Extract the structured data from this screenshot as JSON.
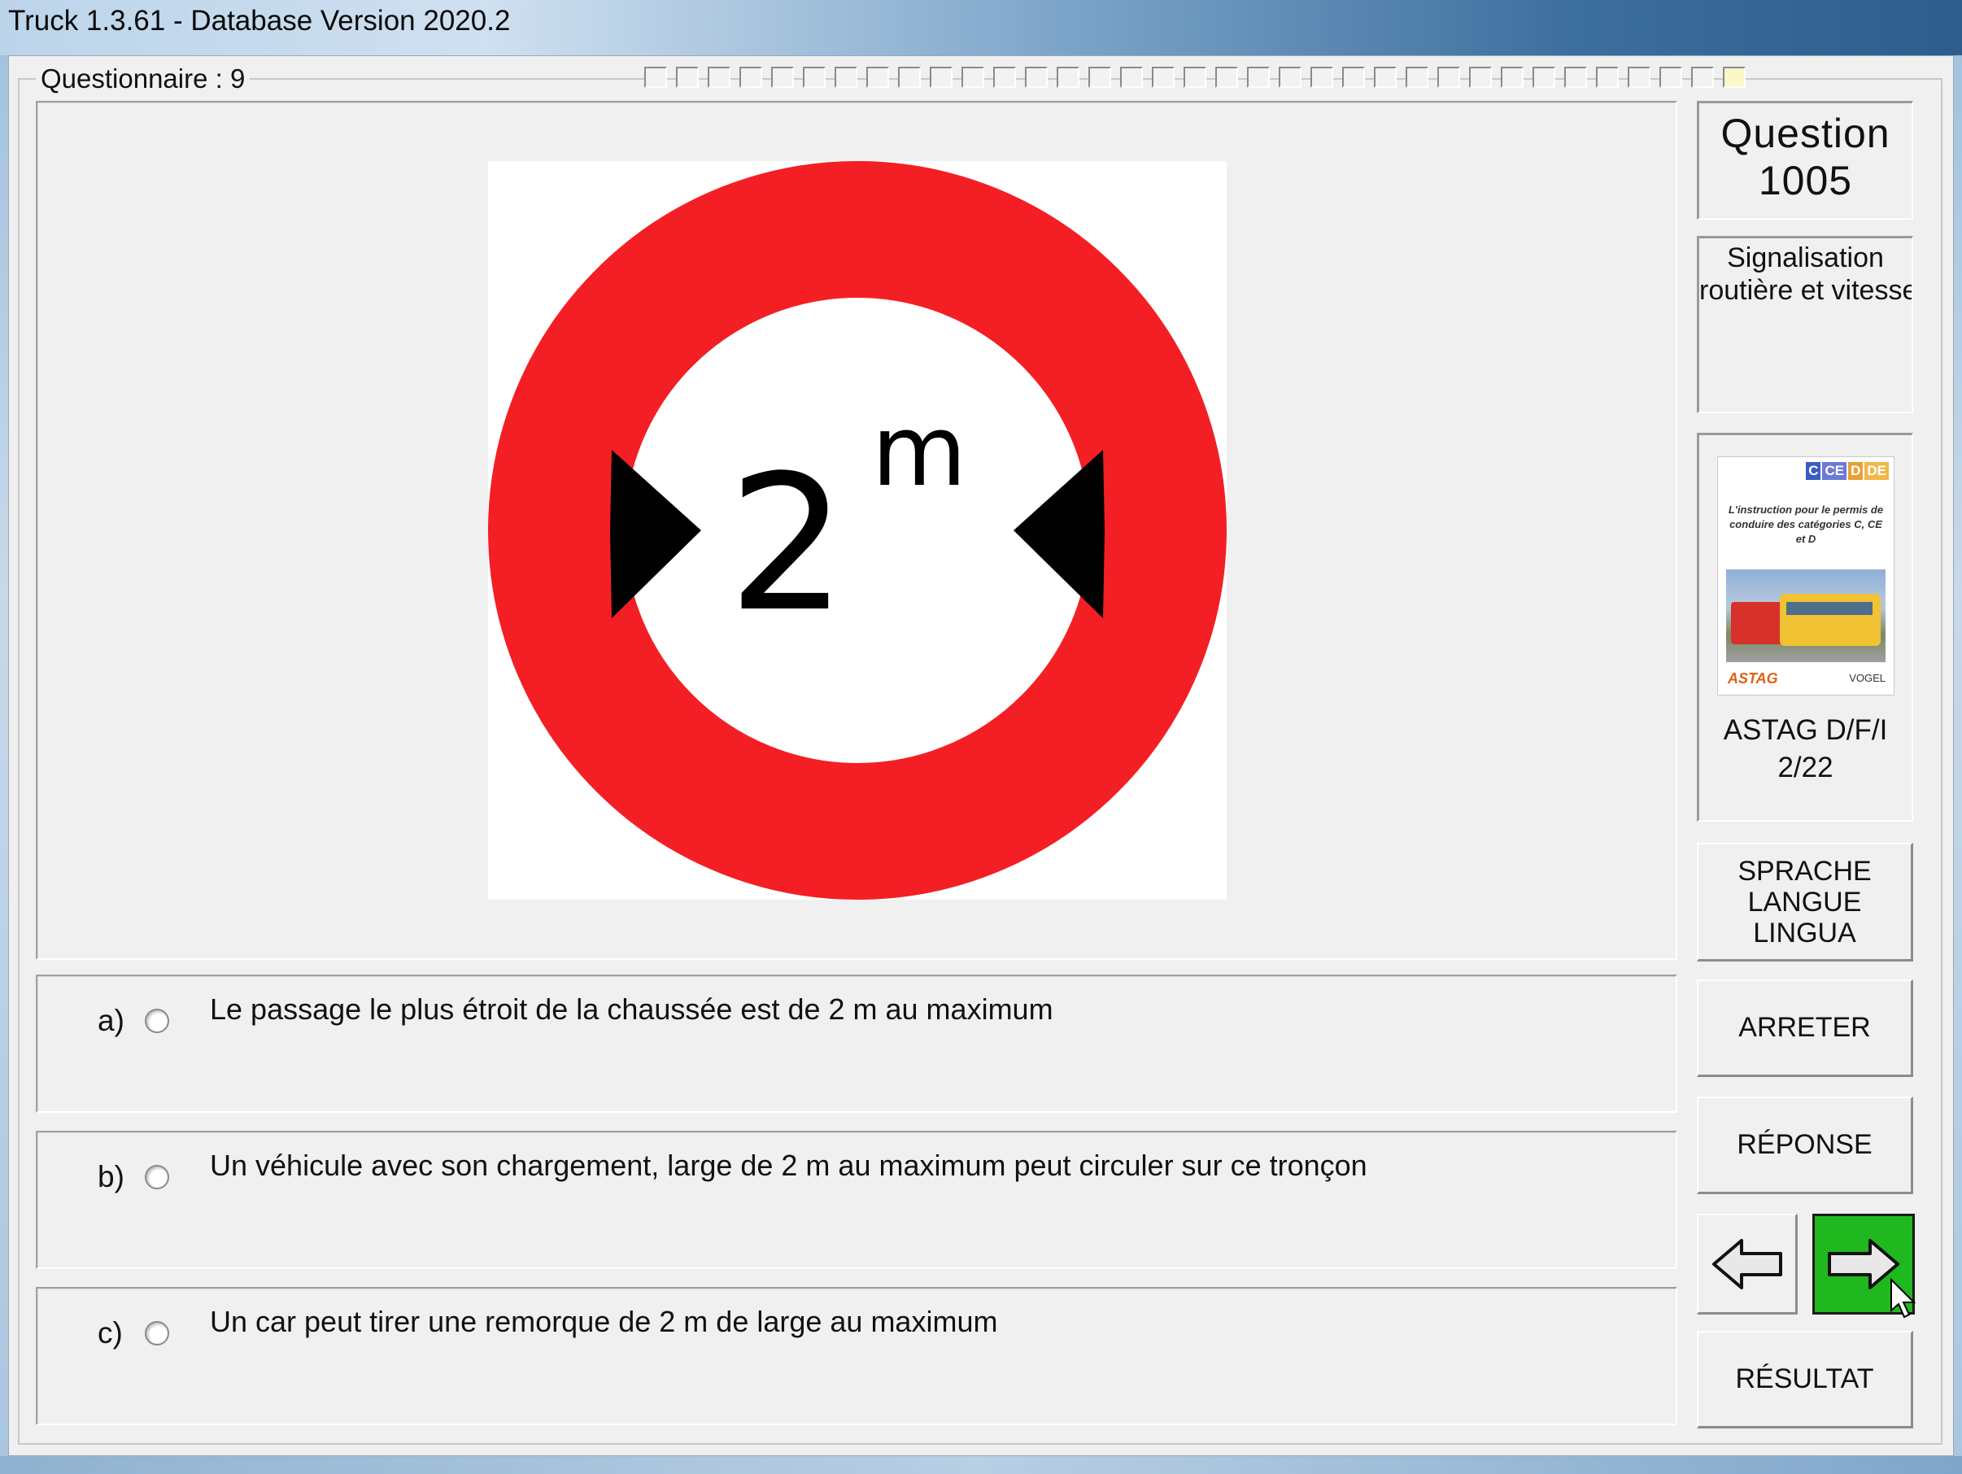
{
  "window": {
    "title": "Truck 1.3.61 - Database Version 2020.2"
  },
  "questionnaire": {
    "label": "Questionnaire : 9",
    "progress_total": 35,
    "progress_current": 35
  },
  "sign": {
    "value": "2",
    "unit": "m",
    "ring_color": "#f41f24",
    "arrow_color": "#000000"
  },
  "answers": [
    {
      "letter": "a)",
      "text": "Le passage le plus étroit de la chaussée est de 2 m au maximum",
      "selected": false
    },
    {
      "letter": "b)",
      "text": "Un véhicule avec son chargement, large de 2 m au maximum peut circuler sur ce tronçon",
      "selected": false
    },
    {
      "letter": "c)",
      "text": "Un car peut tirer une remorque de 2 m de large au maximum",
      "selected": false
    }
  ],
  "question": {
    "label": "Question",
    "number": "1005"
  },
  "category": {
    "line1": "Signalisation",
    "line2": "routière et vitesse"
  },
  "reference": {
    "book_tags": [
      "C",
      "CE",
      "D",
      "DE"
    ],
    "book_title": "L'instruction pour le permis de conduire des catégories C, CE et D",
    "publisher1": "ASTAG",
    "publisher2": "VOGEL",
    "caption_line1": "ASTAG D/F/I",
    "caption_line2": "2/22"
  },
  "buttons": {
    "language_line1": "SPRACHE",
    "language_line2": "LANGUE",
    "language_line3": "LINGUA",
    "stop": "ARRETER",
    "answer": "RÉPONSE",
    "previous_icon": "arrow-left-icon",
    "next_icon": "arrow-right-icon",
    "result": "RÉSULTAT"
  },
  "colors": {
    "next_button": "#1fb81f",
    "current_progress": "#fbf7c8"
  }
}
